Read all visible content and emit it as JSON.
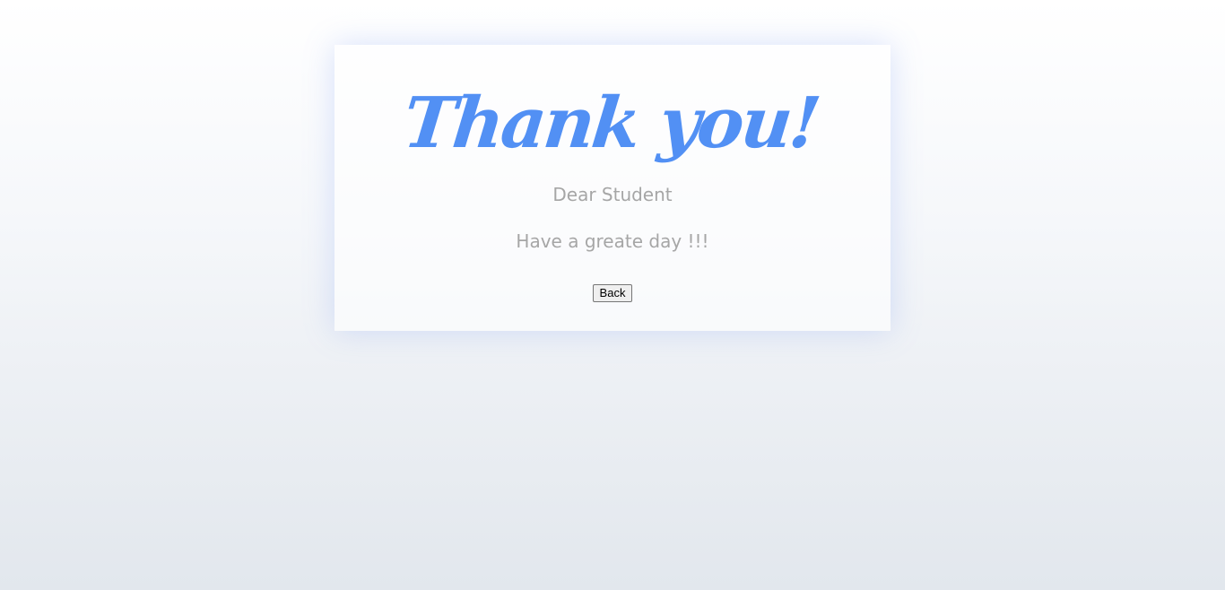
{
  "card": {
    "title": "Thank you!",
    "greeting": "Dear Student",
    "message": "Have a greate day !!!",
    "back_label": "Back"
  },
  "colors": {
    "title": "#5290f4",
    "text": "#a6a6a6",
    "card_glow": "#7896f5"
  }
}
